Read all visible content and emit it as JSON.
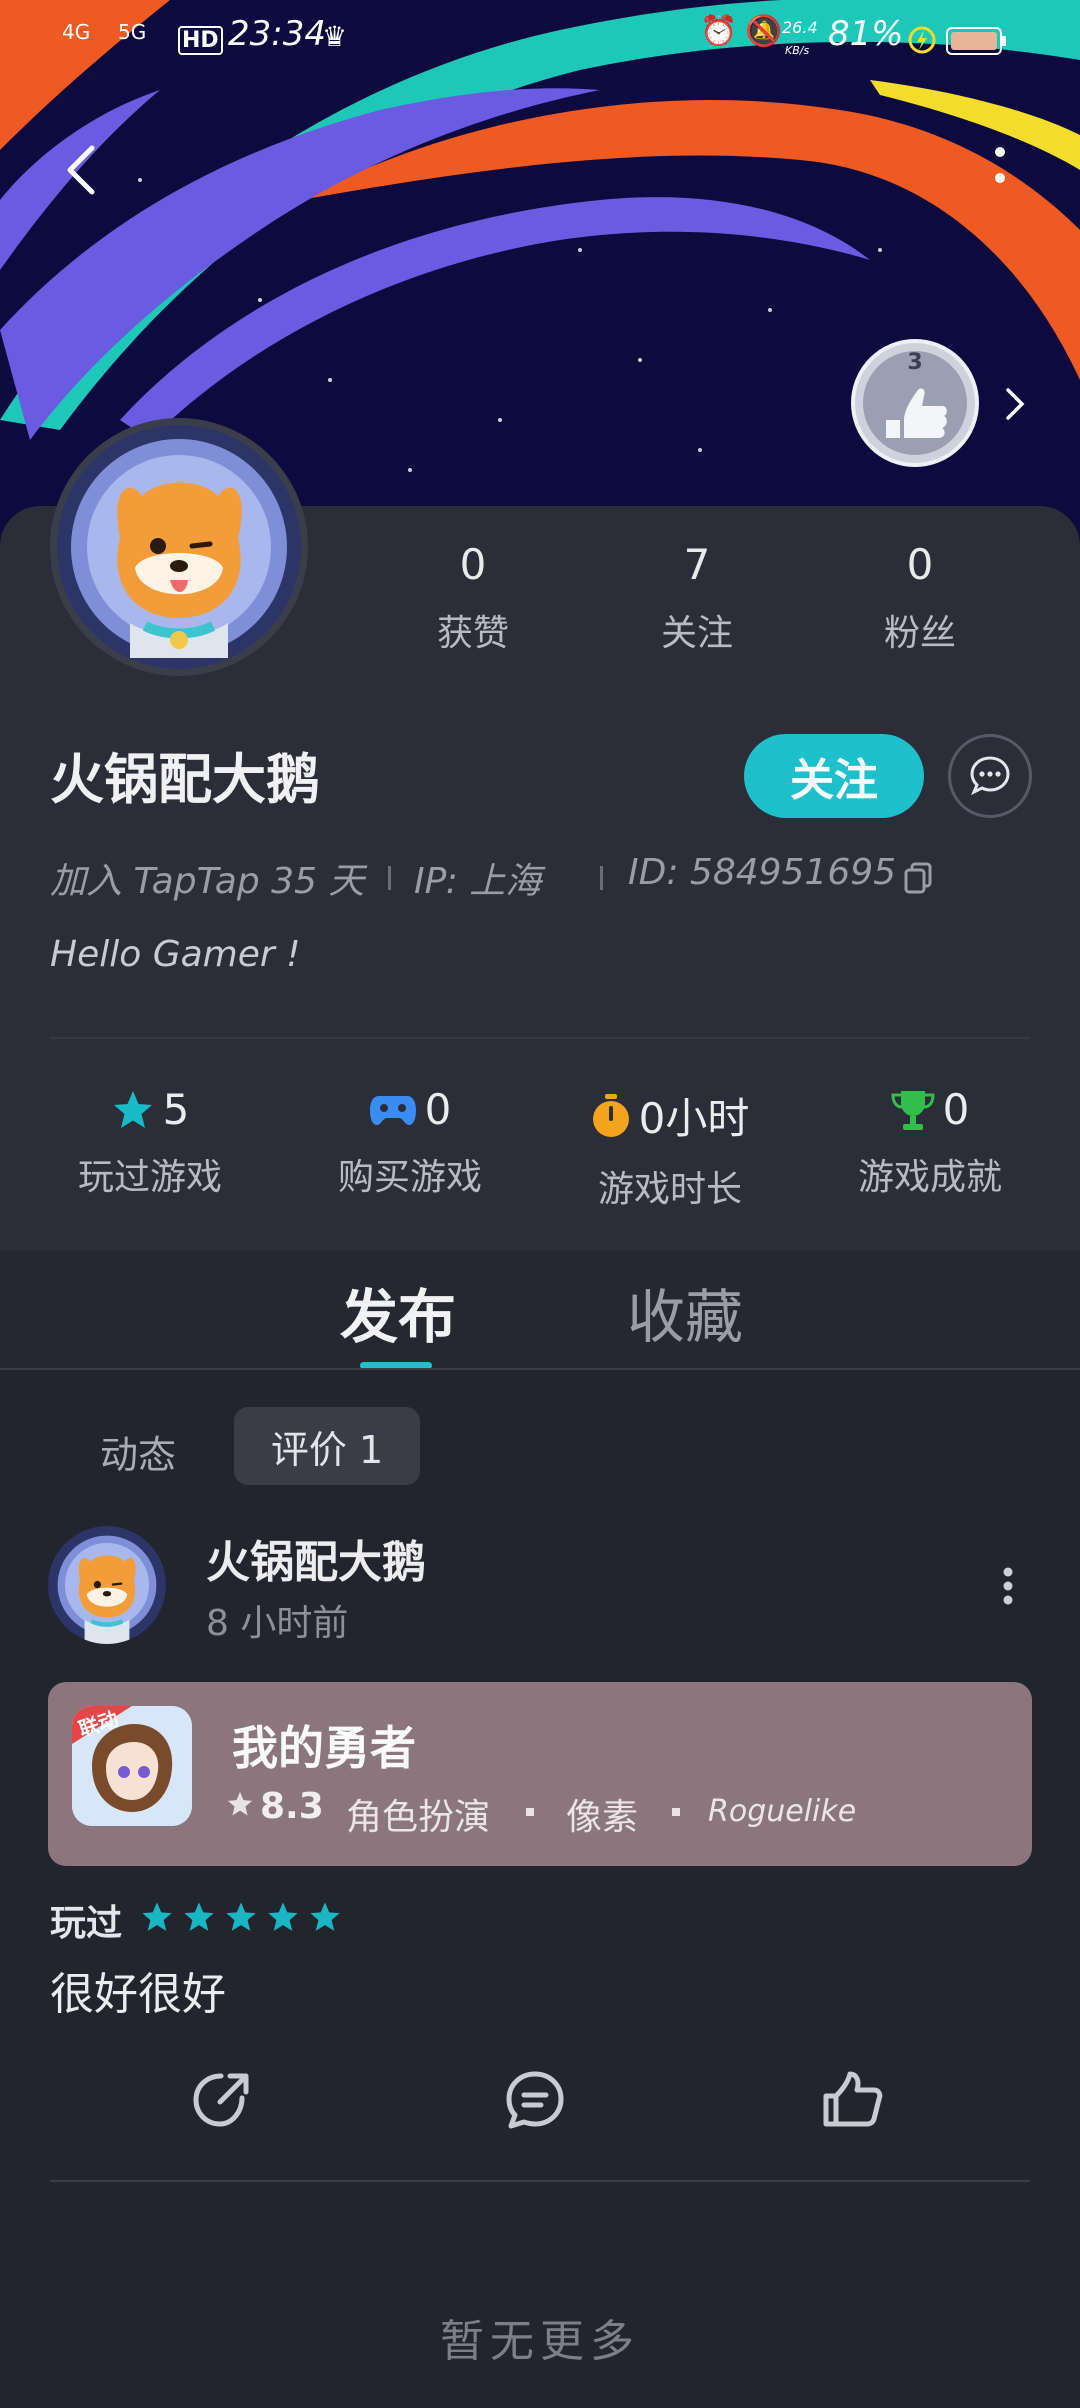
{
  "status_bar": {
    "network": "4G",
    "network2": "5G",
    "hd": "HD",
    "time": "23:34",
    "speed": "26.4",
    "speed_unit": "KB/s",
    "battery": "81%"
  },
  "badge": {
    "count": "3"
  },
  "profile": {
    "name": "火锅配大鹅",
    "stats": [
      {
        "value": "0",
        "label": "获赞"
      },
      {
        "value": "7",
        "label": "关注"
      },
      {
        "value": "0",
        "label": "粉丝"
      }
    ],
    "follow_label": "关注",
    "join_text": "加入 TapTap 35 天",
    "ip_text": "IP:  上海",
    "id_text": "ID:  584951695",
    "bio": "Hello Gamer !"
  },
  "game_stats": [
    {
      "value": "5",
      "label": "玩过游戏",
      "color": "#18bcc8",
      "icon": "star-icon"
    },
    {
      "value": "0",
      "label": "购买游戏",
      "color": "#3b8cf0",
      "icon": "gamepad-icon"
    },
    {
      "value": "0小时",
      "label": "游戏时长",
      "color": "#f3a41c",
      "icon": "stopwatch-icon"
    },
    {
      "value": "0",
      "label": "游戏成就",
      "color": "#2fbf4a",
      "icon": "trophy-icon"
    }
  ],
  "tabs": [
    {
      "label": "发布",
      "active": true
    },
    {
      "label": "收藏",
      "active": false
    }
  ],
  "subtabs": [
    {
      "label": "动态",
      "active": false
    },
    {
      "label": "评价 1",
      "active": true
    }
  ],
  "post": {
    "author": "火锅配大鹅",
    "time": "8 小时前",
    "game": {
      "title": "我的勇者",
      "icon_text": "联动",
      "score": "8.3",
      "tags": [
        "角色扮演",
        "像素",
        "Roguelike"
      ]
    },
    "played_label": "玩过",
    "rating": 5,
    "content": "很好很好"
  },
  "footer": "暂无更多",
  "colors": {
    "accent": "#1ec0cc",
    "card_bg": "#2b2e38",
    "page_bg": "#23252e",
    "game_card": "#8a767c",
    "star": "#19b6c3"
  }
}
